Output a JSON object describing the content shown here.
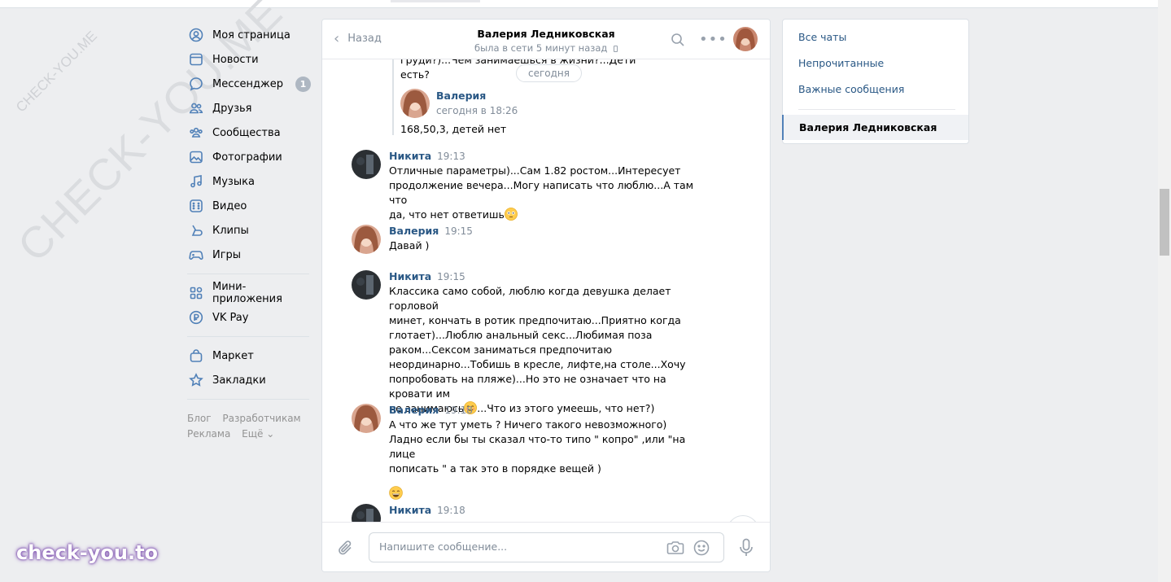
{
  "nav": {
    "items": [
      {
        "label": "Моя страница",
        "icon": "user-circle-icon"
      },
      {
        "label": "Новости",
        "icon": "news-icon"
      },
      {
        "label": "Мессенджер",
        "icon": "messenger-icon",
        "badge": "1"
      },
      {
        "label": "Друзья",
        "icon": "friends-icon"
      },
      {
        "label": "Сообщества",
        "icon": "communities-icon"
      },
      {
        "label": "Фотографии",
        "icon": "photos-icon"
      },
      {
        "label": "Музыка",
        "icon": "music-icon"
      },
      {
        "label": "Видео",
        "icon": "video-icon"
      },
      {
        "label": "Клипы",
        "icon": "clips-icon"
      },
      {
        "label": "Игры",
        "icon": "games-icon"
      }
    ],
    "items2": [
      {
        "label": "Мини-приложения",
        "icon": "mini-apps-icon"
      },
      {
        "label": "VK Pay",
        "icon": "vk-pay-icon"
      }
    ],
    "items3": [
      {
        "label": "Маркет",
        "icon": "market-icon"
      },
      {
        "label": "Закладки",
        "icon": "bookmarks-icon"
      }
    ],
    "footer": {
      "blog": "Блог",
      "developers": "Разработчикам",
      "ads": "Реклама",
      "more": "Ещё ⌄"
    }
  },
  "chat": {
    "back_label": "Назад",
    "peer_name": "Валерия Ледниковская",
    "peer_status": "была в сети 5 минут назад",
    "date_pill": "сегодня",
    "forwarded": {
      "prev_text": "груди?)...Чем занимаешься в жизни?...Дети есть?",
      "author": "Валерия",
      "time": "сегодня в 18:26",
      "text": "168,50,3, детей нет"
    },
    "messages": [
      {
        "author": "Никита",
        "time": "19:13",
        "text": "Отличные параметры)...Сам 1.82 ростом...Интересует\nпродолжение вечера...Могу написать что люблю...А там что\nда, что нет ответишь",
        "emoji_after": true
      },
      {
        "author": "Валерия",
        "time": "19:15",
        "text": "Давай )"
      },
      {
        "author": "Никита",
        "time": "19:15",
        "text": "Классика само собой, люблю когда девушка делает горловой\nминет, кончать в ротик предпочитаю...Приятно когда\nглотает)...Люблю анальный секс...Любимая поза\nраком...Сексом заниматься предпочитаю\nнеординарно...Тобишь в кресле, лифте,на столе...Хочу\nпопробовать на пляже)...Но это не означает что на кровати им\nне занимаюсь",
        "tail": "...Что из этого умеешь, что нет?)"
      },
      {
        "author": "Валерия",
        "time": "19:18",
        "text": "А что же тут уметь ? Ничего такого невозможного)\nЛадно если бы ты сказал что-то типо \" копро\" ,или \"на лице\nпописать \" а так это в порядке вещей )"
      },
      {
        "author": "Никита",
        "time": "19:18",
        "text": ""
      }
    ],
    "composer_placeholder": "Напишите сообщение..."
  },
  "right": {
    "all_chats": "Все чаты",
    "unread": "Непрочитанные",
    "important": "Важные сообщения",
    "active_chat": "Валерия Ледниковская"
  },
  "watermarks": {
    "small": "CHECK-YOU.ME",
    "big": "CHECK-YOU.ME",
    "bottom": "check-you.to"
  },
  "colors": {
    "accent": "#5181b8",
    "link": "#2a5885",
    "bg": "#edeef0"
  }
}
